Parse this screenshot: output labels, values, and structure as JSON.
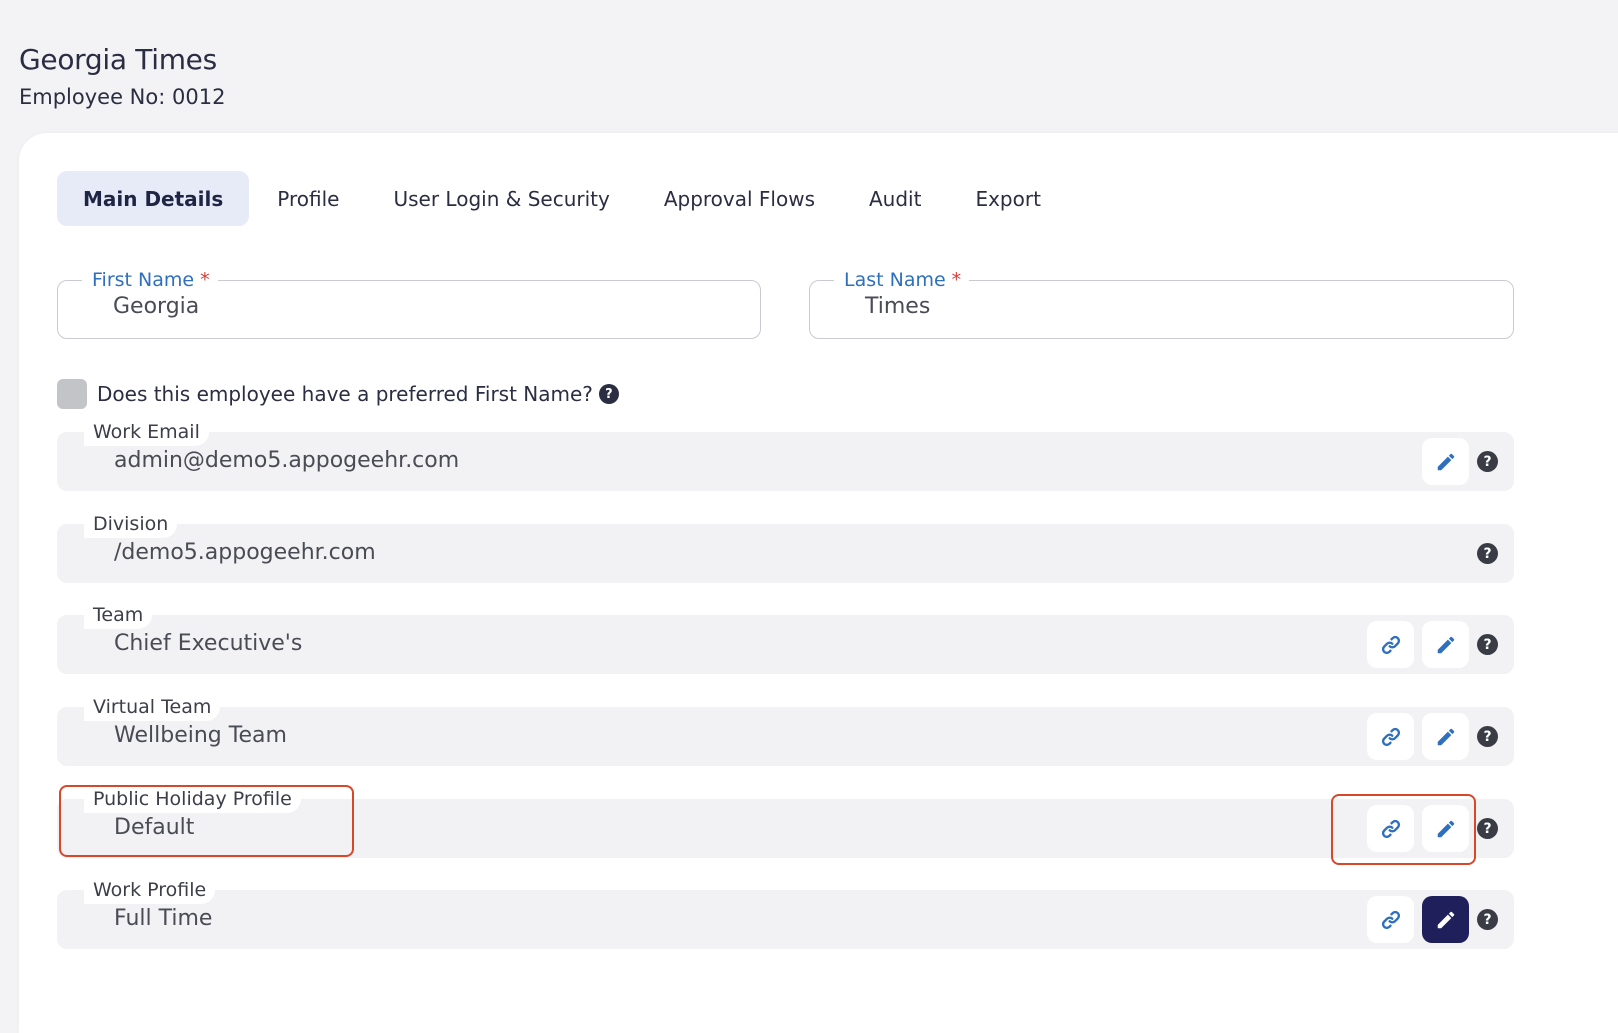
{
  "header": {
    "name": "Georgia Times",
    "employee_no": "Employee No: 0012"
  },
  "tabs": [
    {
      "label": "Main Details",
      "active": true
    },
    {
      "label": "Profile"
    },
    {
      "label": "User Login & Security"
    },
    {
      "label": "Approval Flows"
    },
    {
      "label": "Audit"
    },
    {
      "label": "Export"
    }
  ],
  "first_name": {
    "label": "First Name",
    "required": "*",
    "value": "Georgia"
  },
  "last_name": {
    "label": "Last Name",
    "required": "*",
    "value": "Times"
  },
  "preferred_name": {
    "label": "Does this employee have a preferred First Name?",
    "checked": false
  },
  "fields": {
    "work_email": {
      "label": "Work Email",
      "value": "admin@demo5.appogeehr.com"
    },
    "division": {
      "label": "Division",
      "value": "/demo5.appogeehr.com"
    },
    "team": {
      "label": "Team",
      "value": "Chief Executive's"
    },
    "virtual_team": {
      "label": "Virtual Team",
      "value": "Wellbeing Team"
    },
    "public_holiday_profile": {
      "label": "Public Holiday Profile",
      "value": "Default"
    },
    "work_profile": {
      "label": "Work Profile",
      "value": "Full Time"
    }
  },
  "icons": {
    "link": "link-icon",
    "edit": "pencil-icon",
    "help": "question-circle-icon"
  },
  "colors": {
    "accent_blue": "#2f6fbf",
    "required_red": "#d83a3a",
    "active_tab_bg": "#e7ebf7",
    "dark_button": "#1f1f5c",
    "highlight_red": "#d9472b"
  }
}
